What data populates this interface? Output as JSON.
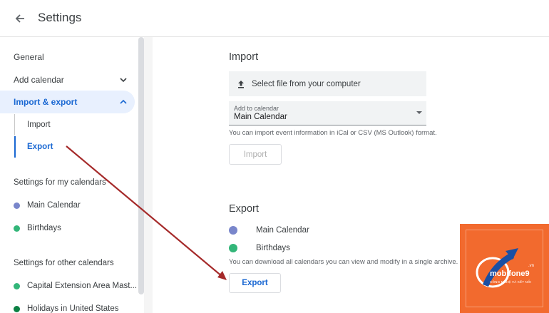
{
  "header": {
    "title": "Settings"
  },
  "sidebar": {
    "nav": [
      {
        "label": "General"
      },
      {
        "label": "Add calendar"
      },
      {
        "label": "Import & export"
      }
    ],
    "sub_items": [
      {
        "label": "Import"
      },
      {
        "label": "Export"
      }
    ],
    "my_calendars_heading": "Settings for my calendars",
    "my_calendars": [
      {
        "label": "Main Calendar",
        "color": "#7986cb"
      },
      {
        "label": "Birthdays",
        "color": "#33b679"
      }
    ],
    "other_calendars_heading": "Settings for other calendars",
    "other_calendars": [
      {
        "label": "Capital Extension Area Mast...",
        "color": "#33b679"
      },
      {
        "label": "Holidays in United States",
        "color": "#0b8043"
      }
    ]
  },
  "import": {
    "heading": "Import",
    "file_button": "Select file from your computer",
    "add_to_label": "Add to calendar",
    "add_to_value": "Main Calendar",
    "help": "You can import event information in iCal or CSV (MS Outlook) format.",
    "button": "Import"
  },
  "export": {
    "heading": "Export",
    "calendars": [
      {
        "label": "Main Calendar",
        "color": "#7986cb"
      },
      {
        "label": "Birthdays",
        "color": "#33b679"
      }
    ],
    "help": "You can download all calendars you can view and modify in a single archive.",
    "button": "Export"
  },
  "watermark": {
    "name": "mobifone9",
    "domain": ".vn",
    "tagline": "CÔNG NGHỆ VÀ KẾT NỐI"
  },
  "colors": {
    "accent": "#1967d2",
    "annotation_arrow": "#a52a2a",
    "badge": "#f26a2e"
  }
}
